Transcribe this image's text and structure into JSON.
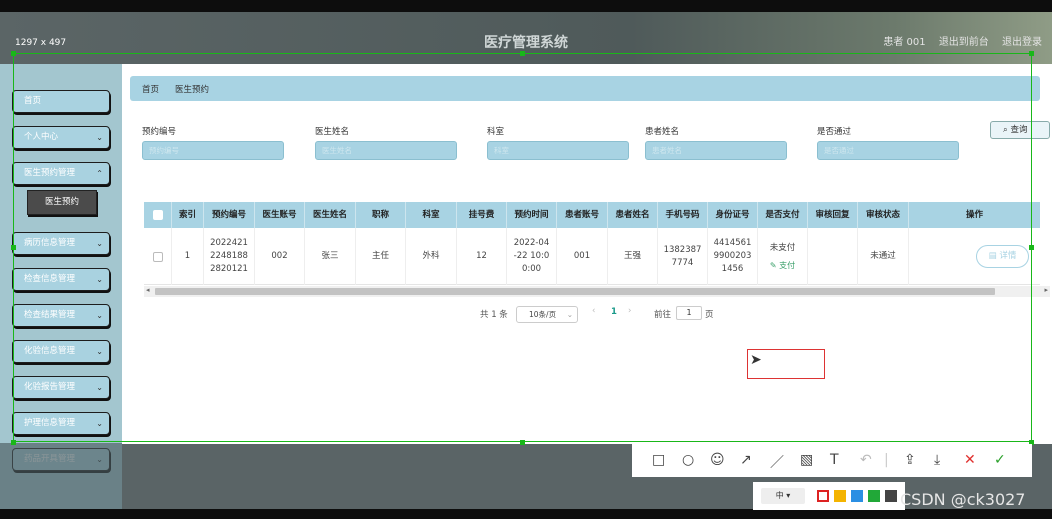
{
  "size_label": "1297 x 497",
  "header": {
    "title": "医疗管理系统",
    "user": "患者 001",
    "back_home": "退出到前台",
    "logout": "退出登录"
  },
  "sidebar": {
    "items": [
      {
        "label": "首页"
      },
      {
        "label": "个人中心"
      },
      {
        "label": "医生预约管理"
      },
      {
        "label": "病历信息管理"
      },
      {
        "label": "检查信息管理"
      },
      {
        "label": "检查结果管理"
      },
      {
        "label": "化验信息管理"
      },
      {
        "label": "化验报告管理"
      },
      {
        "label": "护理信息管理"
      },
      {
        "label": "药品开具管理"
      }
    ],
    "submenu_active": "医生预约"
  },
  "breadcrumb": {
    "home": "首页",
    "current": "医生预约"
  },
  "filters": [
    {
      "label": "预约编号",
      "placeholder": "预约编号"
    },
    {
      "label": "医生姓名",
      "placeholder": "医生姓名"
    },
    {
      "label": "科室",
      "placeholder": "科室"
    },
    {
      "label": "患者姓名",
      "placeholder": "患者姓名"
    },
    {
      "label": "是否通过",
      "placeholder": "是否通过"
    }
  ],
  "query_button": "查询",
  "table": {
    "headers": [
      "索引",
      "预约编号",
      "医生账号",
      "医生姓名",
      "职称",
      "科室",
      "挂号费",
      "预约时间",
      "患者账号",
      "患者姓名",
      "手机号码",
      "身份证号",
      "是否支付",
      "审核回复",
      "审核状态",
      "操作"
    ],
    "rows": [
      {
        "index": "1",
        "booking_no": "20224212248188282012 1",
        "booking_no_lines": [
          "2022421",
          "2248188",
          "2820121"
        ],
        "doctor_account": "002",
        "doctor_name": "张三",
        "title": "主任",
        "department": "外科",
        "fee": "12",
        "time_lines": [
          "2022-04",
          "-22 10:0",
          "0:00"
        ],
        "patient_account": "001",
        "patient_name": "王强",
        "phone_lines": [
          "1382387",
          "7774"
        ],
        "id_lines": [
          "4414561",
          "9900203",
          "1456"
        ],
        "paid": "未支付",
        "pay_link": "支付",
        "reply": "",
        "status": "未通过",
        "detail": "详情"
      }
    ]
  },
  "pager": {
    "total": "共 1 条",
    "page_size": "10条/页",
    "page": "1",
    "goto": "前往",
    "goto_value": "1",
    "page_unit": "页"
  },
  "capture_tools": {
    "font_size": "中"
  },
  "watermark": "CSDN @ck3027",
  "colors": {
    "accent": "#a8d3e3",
    "selection": "#19b719",
    "red": "#dd2222"
  }
}
